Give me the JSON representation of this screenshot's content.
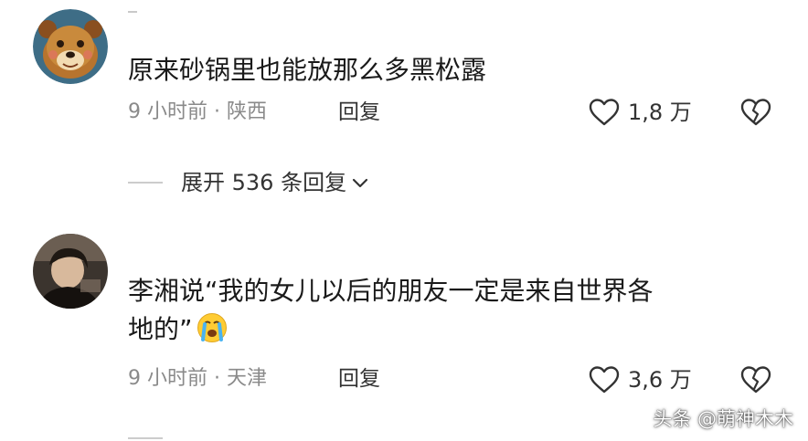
{
  "comments": [
    {
      "text": "原来砂锅里也能放那么多黑松露",
      "time_location": "9 小时前 · 陕西",
      "reply_label": "回复",
      "like_count": "1,8 万",
      "avatar_icon": "cartoon-bear-avatar"
    },
    {
      "text_line1": "李湘说“我的女儿以后的朋友一定是来自世界各",
      "text_line2": "地的”",
      "emoji_icon": "crying-face-emoji",
      "time_location": "9 小时前 · 天津",
      "reply_label": "回复",
      "like_count": "3,6 万",
      "avatar_icon": "person-photo-avatar"
    }
  ],
  "expand_replies": {
    "label": "展开 536 条回复"
  },
  "watermark": "头条 @萌神木木",
  "colors": {
    "text": "#1a1a1a",
    "meta": "#8a8a8a",
    "divider": "#cccccc"
  }
}
